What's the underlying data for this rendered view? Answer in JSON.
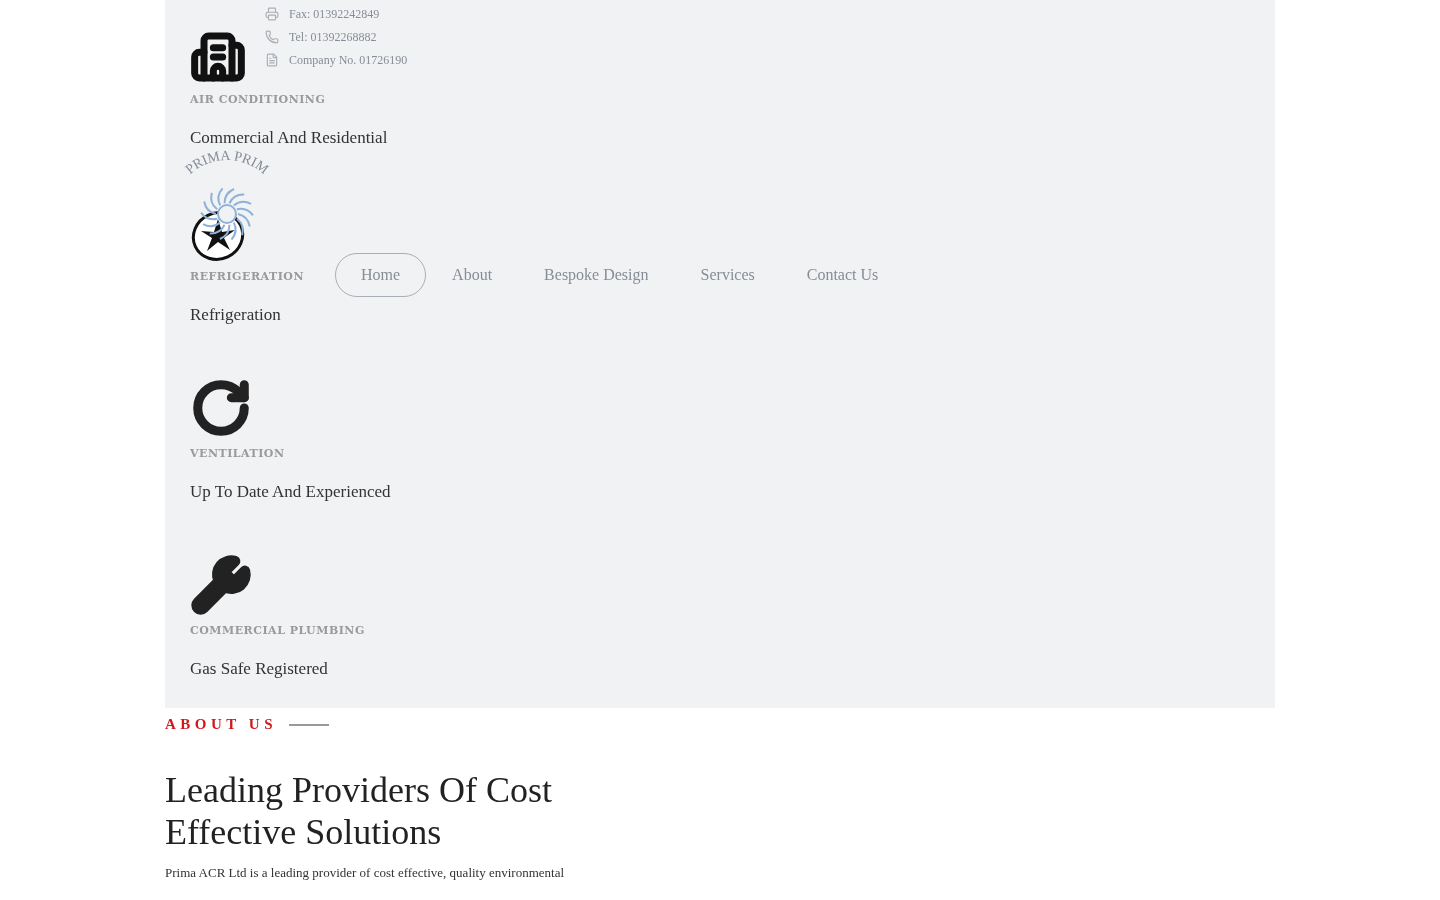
{
  "header": {
    "contacts": [
      "Fax: 01392242849",
      "Tel: 01392268882",
      "Company No. 01726190"
    ],
    "logo_text": "PRIMA PRIM",
    "nav": [
      {
        "label": "Home",
        "selected": true
      },
      {
        "label": "About",
        "selected": false
      },
      {
        "label": "Bespoke Design",
        "selected": false
      },
      {
        "label": "Services",
        "selected": false
      },
      {
        "label": "Contact Us",
        "selected": false
      }
    ]
  },
  "services": [
    {
      "title": "AIR CONDITIONING",
      "description": "Commercial And Residential"
    },
    {
      "title": "REFRIGERATION",
      "description": "Refrigeration"
    },
    {
      "title": "VENTILATION",
      "description": "Up To Date And Experienced"
    },
    {
      "title": "COMMERCIAL PLUMBING",
      "description": "Gas Safe Registered"
    }
  ],
  "about": {
    "eyebrow": "ABOUT US",
    "heading": "Leading Providers Of Cost Effective Solutions",
    "paragraph": "Prima ACR Ltd is a leading provider of cost effective, quality environmental"
  }
}
